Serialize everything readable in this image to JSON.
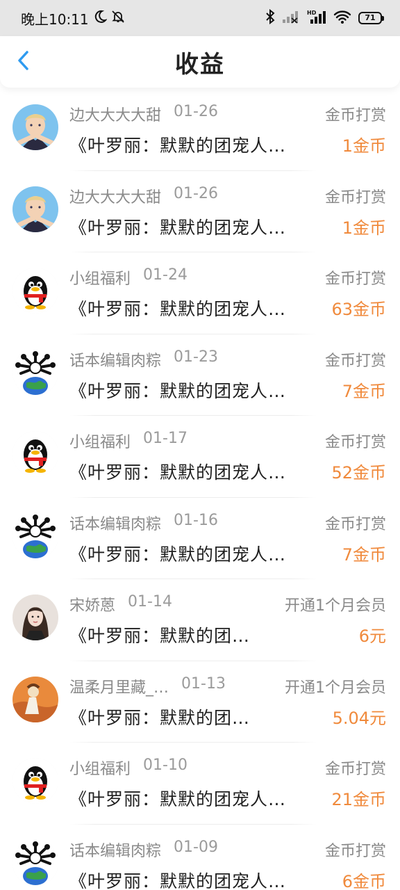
{
  "status_bar": {
    "time": "晚上10:11",
    "battery": "71",
    "icons": [
      "moon-icon",
      "mute-bell-icon",
      "bluetooth-icon",
      "signal-icon",
      "hd-signal-icon",
      "wifi-icon",
      "battery-icon"
    ]
  },
  "header": {
    "title": "收益",
    "back_icon": "chevron-left-icon"
  },
  "colors": {
    "accent_blue": "#2f9bf0",
    "amount_orange": "#f08a3c",
    "secondary_text": "#8a8a8a"
  },
  "records": [
    {
      "name": "边大大大大甜",
      "date": "01-26",
      "type": "金币打赏",
      "work": "《叶罗丽：默默的团宠人…",
      "amount": "1金币",
      "avatar": "boy-avatar"
    },
    {
      "name": "边大大大大甜",
      "date": "01-26",
      "type": "金币打赏",
      "work": "《叶罗丽：默默的团宠人…",
      "amount": "1金币",
      "avatar": "boy-avatar"
    },
    {
      "name": "小组福利",
      "date": "01-24",
      "type": "金币打赏",
      "work": "《叶罗丽：默默的团宠人…",
      "amount": "63金币",
      "avatar": "penguin-avatar"
    },
    {
      "name": "话本编辑肉粽",
      "date": "01-23",
      "type": "金币打赏",
      "work": "《叶罗丽：默默的团宠人…",
      "amount": "7金币",
      "avatar": "globe-avatar"
    },
    {
      "name": "小组福利",
      "date": "01-17",
      "type": "金币打赏",
      "work": "《叶罗丽：默默的团宠人…",
      "amount": "52金币",
      "avatar": "penguin-avatar"
    },
    {
      "name": "话本编辑肉粽",
      "date": "01-16",
      "type": "金币打赏",
      "work": "《叶罗丽：默默的团宠人…",
      "amount": "7金币",
      "avatar": "globe-avatar"
    },
    {
      "name": "宋娇蒽",
      "date": "01-14",
      "type": "开通1个月会员",
      "work": "《叶罗丽：默默的团…",
      "amount": "6元",
      "avatar": "girl-avatar"
    },
    {
      "name": "温柔月里藏_…",
      "date": "01-13",
      "type": "开通1个月会员",
      "work": "《叶罗丽：默默的团…",
      "amount": "5.04元",
      "avatar": "orange-avatar"
    },
    {
      "name": "小组福利",
      "date": "01-10",
      "type": "金币打赏",
      "work": "《叶罗丽：默默的团宠人…",
      "amount": "21金币",
      "avatar": "penguin-avatar"
    },
    {
      "name": "话本编辑肉粽",
      "date": "01-09",
      "type": "金币打赏",
      "work": "《叶罗丽：默默的团宠人…",
      "amount": "6金币",
      "avatar": "globe-avatar"
    }
  ]
}
